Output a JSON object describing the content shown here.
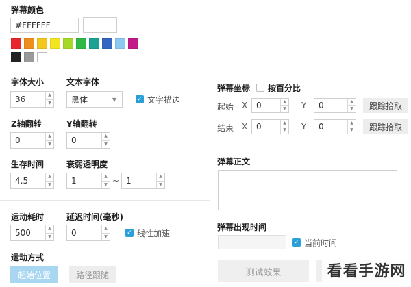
{
  "color_section": {
    "title": "弹幕颜色",
    "hex_value": "#FFFFFF",
    "swatches": [
      "#e8262b",
      "#f08e1b",
      "#f5c61c",
      "#f3e522",
      "#a6d82a",
      "#2fb845",
      "#1aa295",
      "#3465c0",
      "#8cc8f2",
      "#c21a86",
      "#222222",
      "#9a9a9a",
      "#ffffff"
    ]
  },
  "font": {
    "size_label": "字体大小",
    "size_value": "36",
    "family_label": "文本字体",
    "family_value": "黑体",
    "stroke_label": "文字描边"
  },
  "rotation": {
    "z_label": "Z轴翻转",
    "z_value": "0",
    "y_label": "Y轴翻转",
    "y_value": "0"
  },
  "life": {
    "lifetime_label": "生存时间",
    "lifetime_value": "4.5",
    "fade_label": "衰弱透明度",
    "fade_from": "1",
    "fade_sep": "~",
    "fade_to": "1"
  },
  "motion": {
    "duration_label": "运动耗时",
    "duration_value": "500",
    "delay_label": "延迟时间(毫秒)",
    "delay_value": "0",
    "linear_label": "线性加速",
    "mode_label": "运动方式",
    "start_button": "起始位置",
    "path_button": "路径跟随"
  },
  "coords": {
    "title": "弹幕坐标",
    "percent_label": "按百分比",
    "start_label": "起始",
    "end_label": "结束",
    "x_label": "X",
    "y_label": "Y",
    "start_x": "0",
    "start_y": "0",
    "end_x": "0",
    "end_y": "0",
    "pick_button": "跟踪拾取"
  },
  "body_section": {
    "title": "弹幕正文"
  },
  "time_section": {
    "title": "弹幕出现时间",
    "current_label": "当前时间"
  },
  "actions": {
    "test_button": "测试效果"
  },
  "watermark": "看看手游网",
  "colors": {
    "accent": "#2a9fd8",
    "button_bg": "#ededed"
  }
}
